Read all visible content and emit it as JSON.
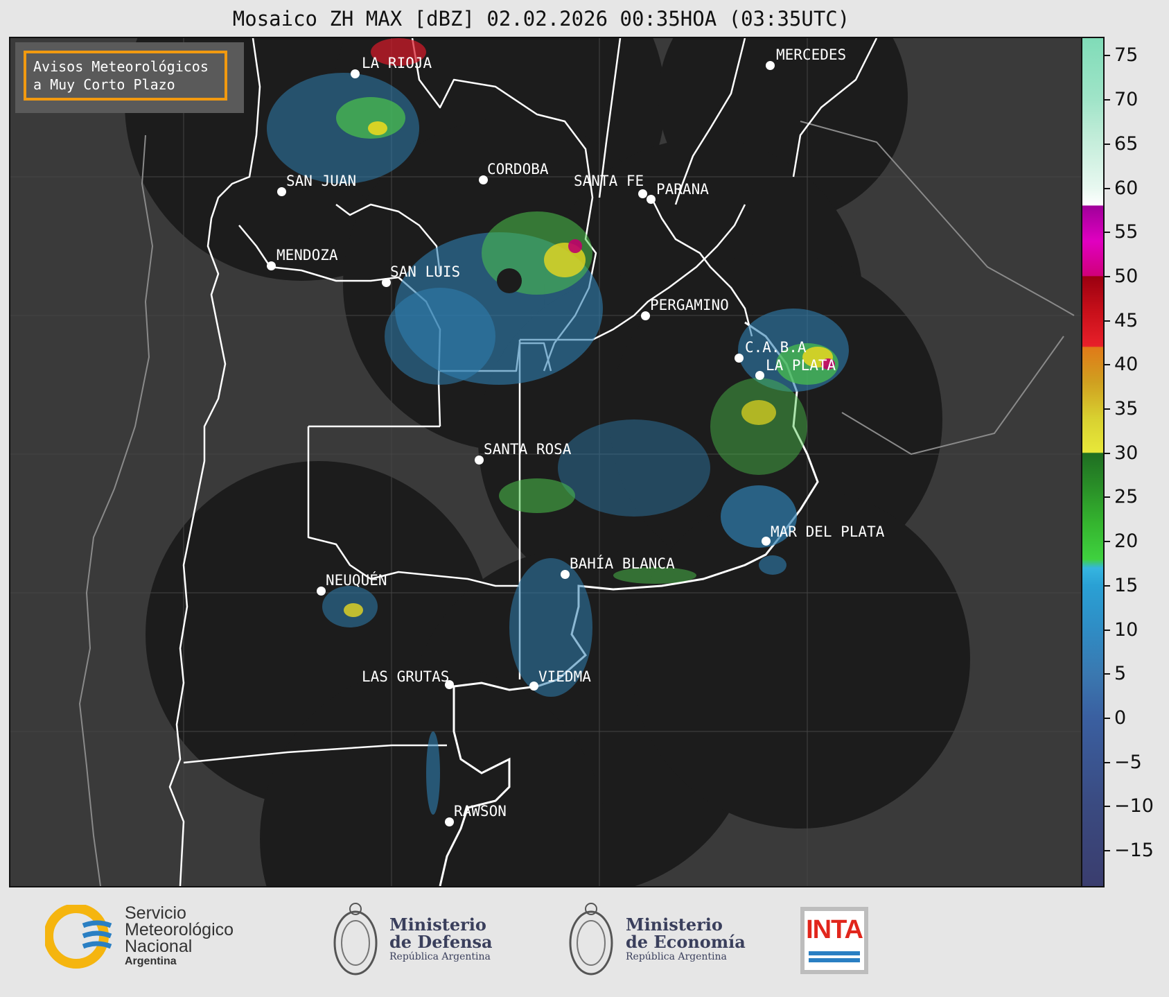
{
  "title": "Mosaico ZH MAX [dBZ] 02.02.2026 00:35HOA (03:35UTC)",
  "avisos": {
    "line1": "Avisos Meteorológicos",
    "line2": "a Muy Corto Plazo"
  },
  "cities": [
    {
      "name": "LA RIOJA"
    },
    {
      "name": "MERCEDES"
    },
    {
      "name": "SAN JUAN"
    },
    {
      "name": "CORDOBA"
    },
    {
      "name": "SANTA FE"
    },
    {
      "name": "PARANA"
    },
    {
      "name": "MENDOZA"
    },
    {
      "name": "SAN LUIS"
    },
    {
      "name": "PERGAMINO"
    },
    {
      "name": "C.A.B.A"
    },
    {
      "name": "LA PLATA"
    },
    {
      "name": "SANTA ROSA"
    },
    {
      "name": "MAR DEL PLATA"
    },
    {
      "name": "BAHÍA BLANCA"
    },
    {
      "name": "NEUQUÉN"
    },
    {
      "name": "LAS GRUTAS"
    },
    {
      "name": "VIEDMA"
    },
    {
      "name": "RAWSON"
    }
  ],
  "colorbar": {
    "unit": "dBZ",
    "range": [
      -19,
      77
    ],
    "ticks": [
      "75",
      "70",
      "65",
      "60",
      "55",
      "50",
      "45",
      "40",
      "35",
      "30",
      "25",
      "20",
      "15",
      "10",
      "5",
      "0",
      "−10",
      "−15",
      "−5"
    ],
    "tick_values": [
      75,
      70,
      65,
      60,
      55,
      50,
      45,
      40,
      35,
      30,
      25,
      20,
      15,
      10,
      5,
      0,
      -10,
      -15,
      -5
    ]
  },
  "logos": {
    "smn": {
      "line1": "Servicio",
      "line2": "Meteorológico",
      "line3": "Nacional",
      "line4": "Argentina"
    },
    "defensa": {
      "line1": "Ministerio",
      "line2": "de Defensa",
      "line3": "República Argentina"
    },
    "economia": {
      "line1": "Ministerio",
      "line2": "de Economía",
      "line3": "República Argentina"
    },
    "inta": {
      "text": "INTA"
    }
  },
  "colors": {
    "map_bg": "#3a3a3a",
    "radar_disk": "#1c1c1c",
    "border": "#ffffff",
    "frame": "#f29a10"
  }
}
